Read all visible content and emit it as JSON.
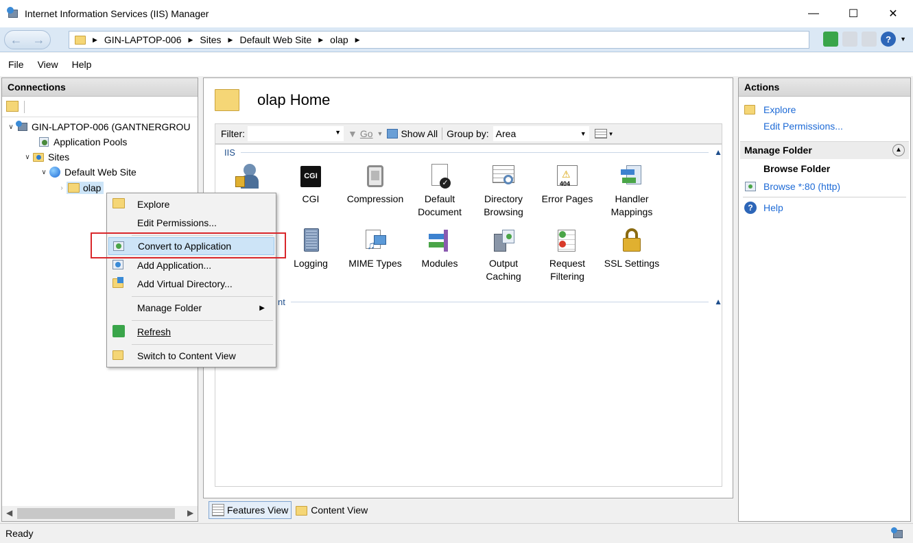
{
  "window": {
    "title": "Internet Information Services (IIS) Manager"
  },
  "address": {
    "segments": [
      "GIN-LAPTOP-006",
      "Sites",
      "Default Web Site",
      "olap"
    ]
  },
  "menu": {
    "file": "File",
    "view": "View",
    "help": "Help"
  },
  "connections": {
    "header": "Connections",
    "tree": {
      "server": "GIN-LAPTOP-006 (GANTNERGROU",
      "app_pools": "Application Pools",
      "sites": "Sites",
      "default_site": "Default Web Site",
      "olap": "olap"
    }
  },
  "center": {
    "title": "olap Home",
    "filter_label": "Filter:",
    "go_label": "Go",
    "show_all": "Show All",
    "group_by_label": "Group by:",
    "group_by_value": "Area",
    "section_iis": "IIS",
    "section_mgmt_partial": "nt",
    "features_row1": [
      {
        "label": "",
        "icon": "authentication-icon"
      },
      {
        "label": "CGI",
        "icon": "cgi-icon"
      },
      {
        "label": "Compression",
        "icon": "compression-icon"
      },
      {
        "label": "Default\nDocument",
        "icon": "default-document-icon"
      },
      {
        "label": "Directory\nBrowsing",
        "icon": "directory-browsing-icon"
      },
      {
        "label": "Error Pages",
        "icon": "error-pages-icon"
      },
      {
        "label": "Handler\nMappings",
        "icon": "handler-mappings-icon"
      }
    ],
    "features_row2": [
      {
        "label": "Logging",
        "icon": "logging-icon"
      },
      {
        "label": "MIME Types",
        "icon": "mime-types-icon"
      },
      {
        "label": "Modules",
        "icon": "modules-icon"
      },
      {
        "label": "Output\nCaching",
        "icon": "output-caching-icon"
      },
      {
        "label": "Request\nFiltering",
        "icon": "request-filtering-icon"
      },
      {
        "label": "SSL Settings",
        "icon": "ssl-settings-icon"
      }
    ],
    "cgi_badge": "CGI",
    "error_badge": "404",
    "features_view": "Features View",
    "content_view": "Content View"
  },
  "actions": {
    "header": "Actions",
    "explore": "Explore",
    "edit_permissions": "Edit Permissions...",
    "manage_folder": "Manage Folder",
    "browse_folder": "Browse Folder",
    "browse_80": "Browse *:80 (http)",
    "help": "Help"
  },
  "context_menu": {
    "explore": "Explore",
    "edit_permissions": "Edit Permissions...",
    "convert": "Convert to Application",
    "add_application": "Add Application...",
    "add_virtual_directory": "Add Virtual Directory...",
    "manage_folder": "Manage Folder",
    "refresh": "Refresh",
    "switch_content": "Switch to Content View"
  },
  "status": {
    "text": "Ready"
  },
  "colors": {
    "highlight_box": "#d9262a",
    "link": "#1d6ad6",
    "menu_highlight": "#cde4f7"
  }
}
